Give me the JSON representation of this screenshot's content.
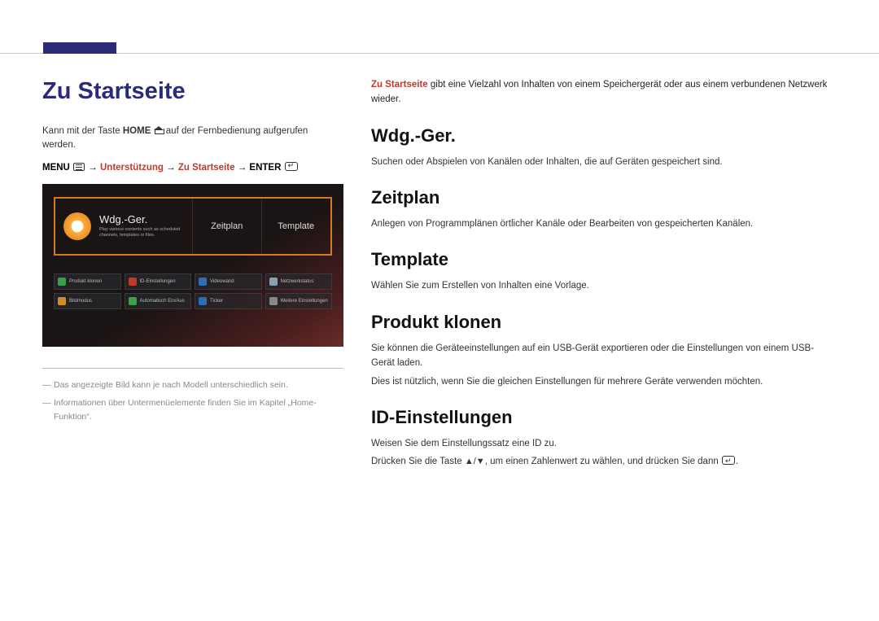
{
  "page": {
    "title": "Zu Startseite",
    "intro_pre": "Kann mit der Taste ",
    "intro_bold": "HOME",
    "intro_post": " auf der Fernbedienung aufgerufen werden.",
    "menupath": {
      "menu": "MENU",
      "arrow": "→",
      "p1": "Unterstützung",
      "p2": "Zu Startseite",
      "enter": "ENTER"
    }
  },
  "screenshot": {
    "big_label": "Wdg.-Ger.",
    "big_sub": "Play various contents such as scheduled channels, templates or files.",
    "tile2": "Zeitplan",
    "tile3": "Template",
    "chips": [
      {
        "label": "Produkt klonen",
        "color": "#3aa04a"
      },
      {
        "label": "ID-Einstellungen",
        "color": "#c0392b"
      },
      {
        "label": "Videowand",
        "color": "#2d6fb5"
      },
      {
        "label": "Netzwerkstatus",
        "color": "#8aa0b0"
      },
      {
        "label": "Bildmodus",
        "color": "#d08a2a"
      },
      {
        "label": "Automatisch Ein/Aus",
        "color": "#3aa04a"
      },
      {
        "label": "Ticker",
        "color": "#2d6fb5"
      },
      {
        "label": "Weitere Einstellungen",
        "color": "#888"
      }
    ]
  },
  "footnotes": {
    "n1": "Das angezeigte Bild kann je nach Modell unterschiedlich sein.",
    "n2": "Informationen über Untermenüelemente finden Sie im Kapitel „Home-Funktion“."
  },
  "right": {
    "intro_red": "Zu Startseite",
    "intro_rest": " gibt eine Vielzahl von Inhalten von einem Speichergerät oder aus einem verbundenen Netzwerk wieder.",
    "sections": {
      "wdg": {
        "h": "Wdg.-Ger.",
        "p": "Suchen oder Abspielen von Kanälen oder Inhalten, die auf Geräten gespeichert sind."
      },
      "zeitplan": {
        "h": "Zeitplan",
        "p": "Anlegen von Programmplänen örtlicher Kanäle oder Bearbeiten von gespeicherten Kanälen."
      },
      "template": {
        "h": "Template",
        "p": "Wählen Sie zum Erstellen von Inhalten eine Vorlage."
      },
      "klonen": {
        "h": "Produkt klonen",
        "p1": "Sie können die Geräteeinstellungen auf ein USB-Gerät exportieren oder die Einstellungen von einem USB-Gerät laden.",
        "p2": "Dies ist nützlich, wenn Sie die gleichen Einstellungen für mehrere Geräte verwenden möchten."
      },
      "id": {
        "h": "ID-Einstellungen",
        "p1": "Weisen Sie dem Einstellungssatz eine ID zu.",
        "p2a": "Drücken Sie die Taste ",
        "p2b": ", um einen Zahlenwert zu wählen, und drücken Sie dann ",
        "p2c": "."
      }
    }
  }
}
